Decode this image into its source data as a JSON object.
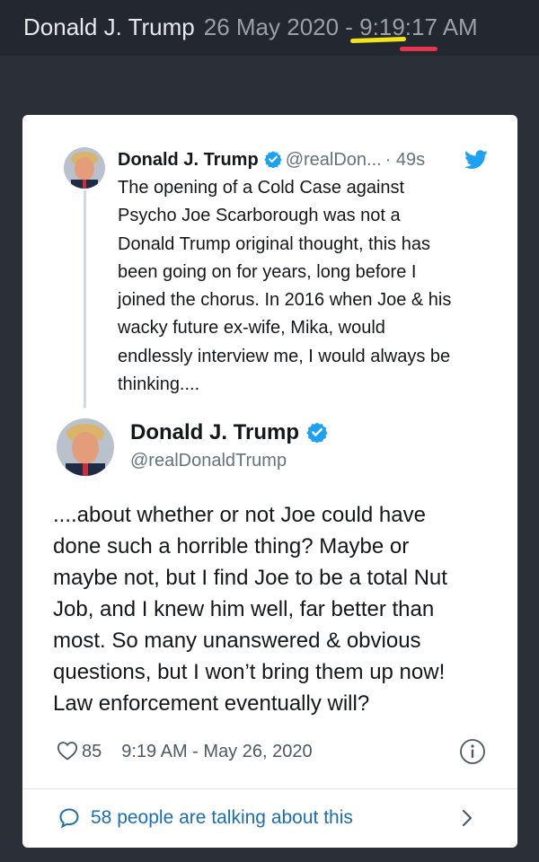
{
  "header": {
    "name": "Donald J. Trump",
    "timestamp": "26 May 2020 - 9:19:17 AM",
    "highlight_colors": [
      "#f2e51a",
      "#e8344c"
    ]
  },
  "quoted_tweet": {
    "name": "Donald J. Trump",
    "handle": "@realDon...",
    "age": "· 49s",
    "text": "The opening of a Cold Case against\nPsycho Joe Scarborough was not a\nDonald Trump original thought, this has\nbeen going on for years, long before I\njoined the chorus. In 2016 when Joe & his\nwacky future ex-wife, Mika, would\nendlessly interview me, I would always be\nthinking....",
    "icons": [
      "avatar",
      "verified-badge-icon",
      "twitter-bird-icon"
    ]
  },
  "main_tweet": {
    "name": "Donald J. Trump",
    "handle": "@realDonaldTrump",
    "text": "....about whether or not Joe could have\ndone such a horrible thing? Maybe or\nmaybe not, but I find Joe to be a total Nut\nJob, and I knew him well, far better than\nmost. So many unanswered & obvious\nquestions, but I won’t bring them up now!\nLaw enforcement eventually will?",
    "likes": "85",
    "timestamp": "9:19 AM - May 26, 2020",
    "icons": [
      "avatar",
      "verified-badge-icon",
      "heart-icon",
      "info-icon"
    ]
  },
  "footer": {
    "talking_label": "58 people are talking about this",
    "icons": [
      "speech-bubble-icon",
      "chevron-right-icon"
    ]
  },
  "colors": {
    "background": "#2b2f37",
    "card": "#ffffff",
    "verified": "#1da1f2",
    "link": "#1a6fb3"
  }
}
